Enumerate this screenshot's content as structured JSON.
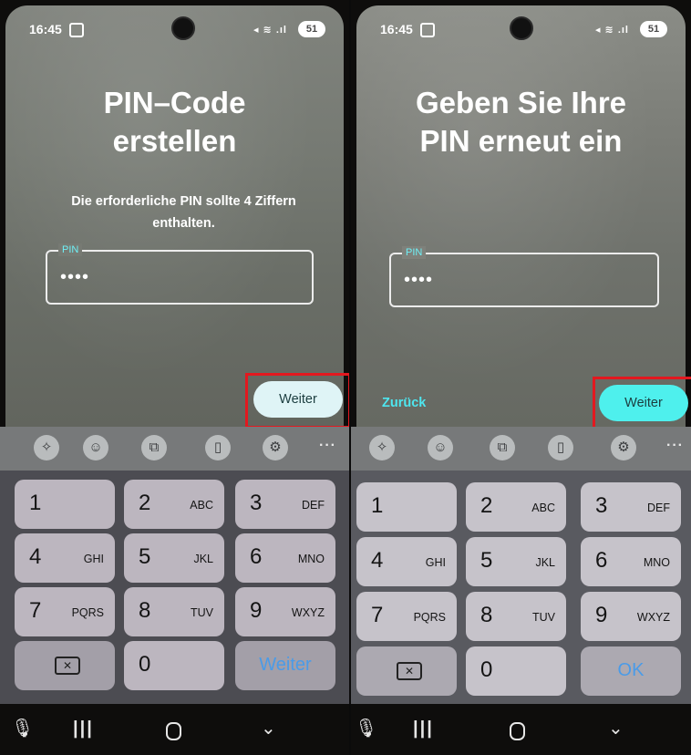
{
  "screens": [
    {
      "status": {
        "time": "16:45",
        "signal": "◂ ≋ .ıl",
        "battery": "51"
      },
      "title_line1": "PIN–Code",
      "title_line2": "erstellen",
      "subtitle_line1": "Die erforderliche PIN sollte 4 Ziffern",
      "subtitle_line2": "enthalten.",
      "pin_label": "PIN",
      "pin_value": "••••",
      "next_button": "Weiter",
      "keyboard_action": "Weiter"
    },
    {
      "status": {
        "time": "16:45",
        "signal": "◂ ≋ .ıl",
        "battery": "51"
      },
      "title_line1": "Geben Sie Ihre",
      "title_line2": "PIN erneut ein",
      "pin_label": "PIN",
      "pin_value": "••••",
      "back_button": "Zurück",
      "next_button": "Weiter",
      "keyboard_action": "OK"
    }
  ],
  "toolbar": {
    "icons": [
      "sparkle-icon",
      "emoji-icon",
      "translate-icon",
      "clipboard-icon",
      "settings-icon"
    ],
    "more": "···"
  },
  "keys": [
    {
      "num": "1",
      "letters": ""
    },
    {
      "num": "2",
      "letters": "ABC"
    },
    {
      "num": "3",
      "letters": "DEF"
    },
    {
      "num": "4",
      "letters": "GHI"
    },
    {
      "num": "5",
      "letters": "JKL"
    },
    {
      "num": "6",
      "letters": "MNO"
    },
    {
      "num": "7",
      "letters": "PQRS"
    },
    {
      "num": "8",
      "letters": "TUV"
    },
    {
      "num": "9",
      "letters": "WXYZ"
    },
    {
      "num": "0",
      "letters": ""
    }
  ],
  "colors": {
    "accent_cyan": "#4ef0ed",
    "highlight_red": "#e3181f",
    "keyboard_action_blue": "#4a9be8"
  }
}
